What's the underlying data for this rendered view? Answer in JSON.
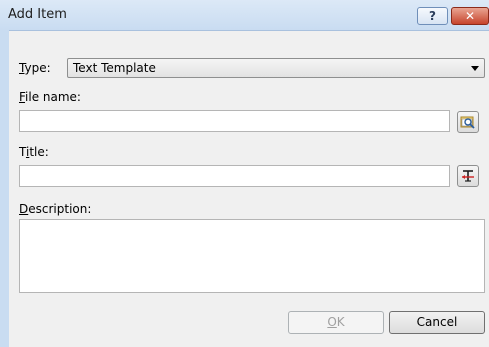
{
  "window": {
    "title": "Add Item",
    "help_glyph": "?",
    "close_glyph": "✕"
  },
  "form": {
    "type_label": "Type:",
    "type_mnemonic": "T",
    "type_rest": "ype:",
    "type_value": "Text Template",
    "file_name_mnemonic": "F",
    "file_name_rest": "ile name:",
    "file_name_value": "",
    "title_prefix": "T",
    "title_mnemonic": "i",
    "title_rest": "tle:",
    "title_value": "",
    "description_mnemonic": "D",
    "description_rest": "escription:",
    "description_value": ""
  },
  "buttons": {
    "ok_mnemonic": "O",
    "ok_rest": "K",
    "ok_enabled": false,
    "cancel_label": "Cancel"
  },
  "icons": {
    "browse": "folder-search-icon",
    "insert_title": "text-insert-icon"
  },
  "colors": {
    "titlebar": "#c9dcf1",
    "close_button": "#c7442c",
    "dialog_bg": "#f0f0f0"
  }
}
